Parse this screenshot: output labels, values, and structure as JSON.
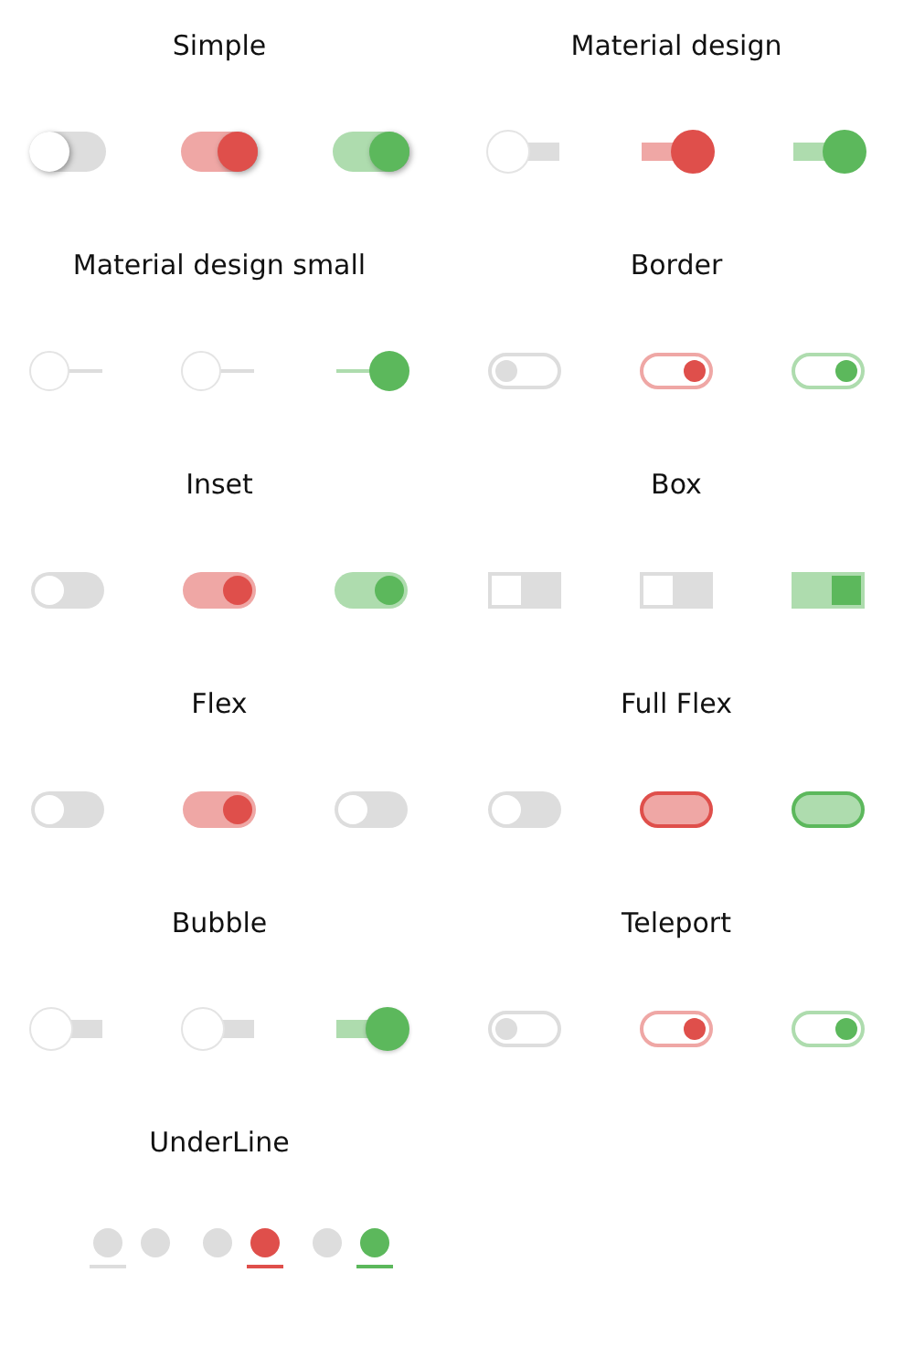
{
  "groups": [
    {
      "title": "Simple",
      "kind": "simple",
      "switches": [
        {
          "checked": false
        },
        {
          "checked": true,
          "color": "#df4f4b"
        },
        {
          "checked": true,
          "color": "#5cb85c"
        }
      ]
    },
    {
      "title": "Material design",
      "kind": "material",
      "switches": [
        {
          "checked": false
        },
        {
          "checked": true,
          "color": "#df4f4b"
        },
        {
          "checked": true,
          "color": "#5cb85c"
        }
      ]
    },
    {
      "title": "Material design small",
      "kind": "material-small",
      "switches": [
        {
          "checked": false
        },
        {
          "checked": false
        },
        {
          "checked": true,
          "color": "#5cb85c"
        }
      ]
    },
    {
      "title": "Border",
      "kind": "border",
      "switches": [
        {
          "checked": false
        },
        {
          "checked": true,
          "color": "#df4f4b"
        },
        {
          "checked": true,
          "color": "#5cb85c"
        }
      ]
    },
    {
      "title": "Inset",
      "kind": "inset",
      "switches": [
        {
          "checked": false
        },
        {
          "checked": true,
          "color": "#df4f4b"
        },
        {
          "checked": true,
          "color": "#5cb85c"
        }
      ]
    },
    {
      "title": "Box",
      "kind": "box",
      "switches": [
        {
          "checked": false
        },
        {
          "checked": false
        },
        {
          "checked": true,
          "color": "#5cb85c"
        }
      ]
    },
    {
      "title": "Flex",
      "kind": "flex",
      "switches": [
        {
          "checked": false
        },
        {
          "checked": true,
          "color": "#df4f4b"
        },
        {
          "checked": false
        }
      ]
    },
    {
      "title": "Full Flex",
      "kind": "full-flex",
      "switches": [
        {
          "checked": false
        },
        {
          "checked": true,
          "color": "#df4f4b"
        },
        {
          "checked": true,
          "color": "#5cb85c"
        }
      ]
    },
    {
      "title": "Bubble",
      "kind": "bubble",
      "switches": [
        {
          "checked": false
        },
        {
          "checked": false
        },
        {
          "checked": true,
          "color": "#5cb85c"
        }
      ]
    },
    {
      "title": "Teleport",
      "kind": "teleport",
      "switches": [
        {
          "checked": false
        },
        {
          "checked": true,
          "color": "#df4f4b"
        },
        {
          "checked": true,
          "color": "#5cb85c"
        }
      ]
    },
    {
      "title": "UnderLine",
      "kind": "underline",
      "switches": [
        {
          "checked": false
        },
        {
          "checked": true,
          "color": "#df4f4b"
        },
        {
          "checked": true,
          "color": "#5cb85c"
        }
      ]
    }
  ]
}
